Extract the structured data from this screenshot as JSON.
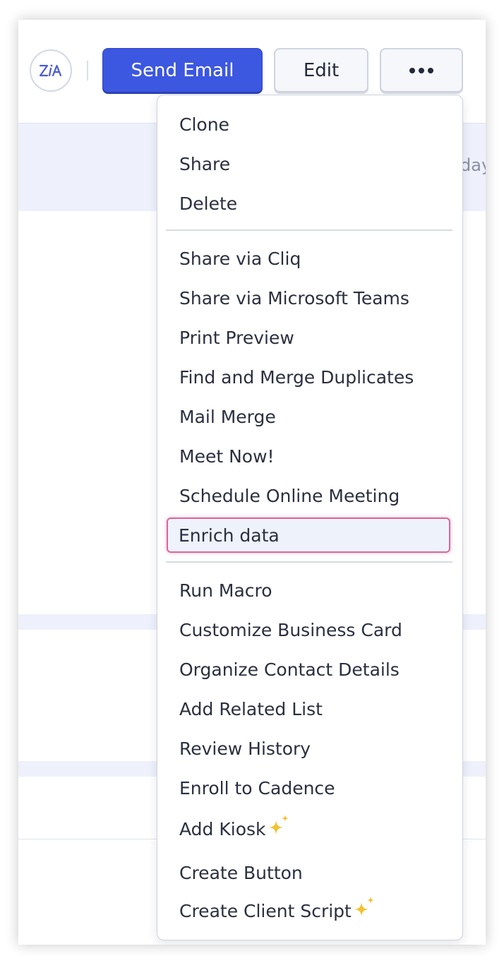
{
  "header": {
    "send_email_label": "Send Email",
    "edit_label": "Edit",
    "more_icon": "more-horizontal-icon",
    "zia_icon": "zia-icon"
  },
  "background": {
    "partial_text": "day"
  },
  "menu": {
    "group1": [
      "Clone",
      "Share",
      "Delete"
    ],
    "group2": [
      "Share via Cliq",
      "Share via Microsoft Teams",
      "Print Preview",
      "Find and Merge Duplicates",
      "Mail Merge",
      "Meet Now!",
      "Schedule Online Meeting",
      "Enrich data"
    ],
    "group3": [
      "Run Macro",
      "Customize Business Card",
      "Organize Contact Details",
      "Add Related List",
      "Review History",
      "Enroll to Cadence",
      "Add Kiosk",
      "Create Button",
      "Create Client Script"
    ],
    "highlighted_item": "Enrich data",
    "new_badge_icon": "sparkle-icon"
  },
  "colors": {
    "primary": "#3c57e0",
    "highlight_border": "#d9679a",
    "sparkle": "#f2c230"
  }
}
